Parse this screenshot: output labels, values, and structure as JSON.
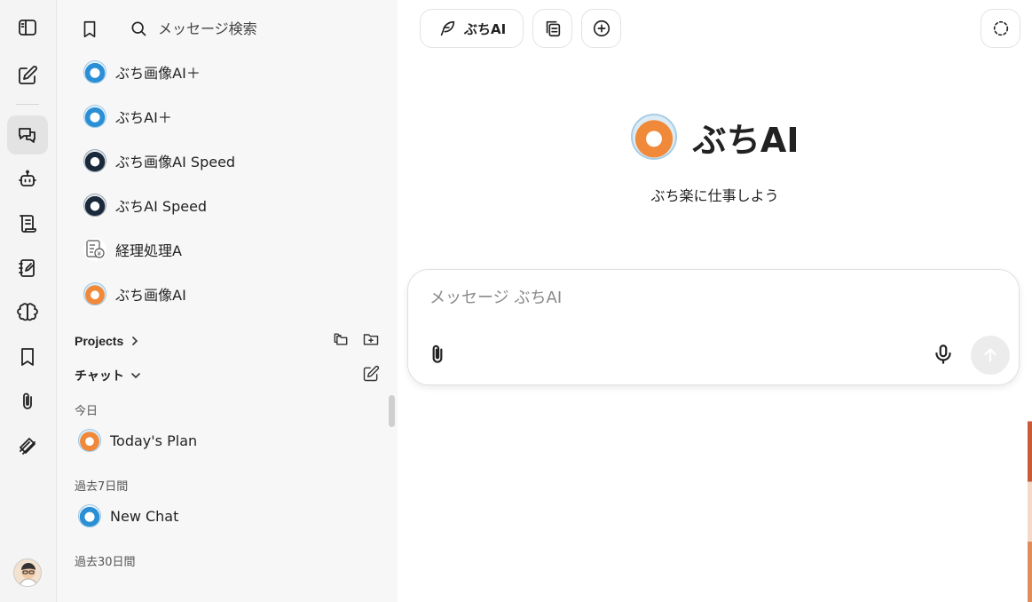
{
  "search": {
    "placeholder": "メッセージ検索"
  },
  "models": [
    {
      "label": "ぶち画像AI＋",
      "avatar": "blue"
    },
    {
      "label": "ぶちAI＋",
      "avatar": "blue"
    },
    {
      "label": "ぶち画像AI Speed",
      "avatar": "dark"
    },
    {
      "label": "ぶちAI Speed",
      "avatar": "dark"
    },
    {
      "label": "経理処理A",
      "avatar": "doc"
    },
    {
      "label": "ぶち画像AI",
      "avatar": "orange"
    }
  ],
  "projects": {
    "title": "Projects"
  },
  "chats": {
    "title": "チャット",
    "groups": [
      {
        "label": "今日",
        "items": [
          {
            "label": "Today's Plan",
            "avatar": "orange"
          }
        ]
      },
      {
        "label": "過去7日間",
        "items": [
          {
            "label": "New Chat",
            "avatar": "blue"
          }
        ]
      },
      {
        "label": "過去30日間",
        "items": []
      }
    ]
  },
  "main": {
    "model_button": "ぶちAI",
    "hero_title": "ぶちAI",
    "hero_subtitle": "ぶち楽に仕事しよう",
    "composer_placeholder": "メッセージ ぶちAI"
  },
  "icons": {
    "rail": [
      "sidebar-toggle-icon",
      "new-note-icon",
      "chats-icon",
      "bot-icon",
      "scroll-icon",
      "notebook-icon",
      "brain-icon",
      "bookmark-icon",
      "paperclip-icon",
      "layers-icon"
    ],
    "top": [
      "feather-icon",
      "copy-icon",
      "plus-circle-icon",
      "dashed-circle-icon"
    ]
  },
  "colors": {
    "active_rail": "#e3e3e3",
    "panel_bg": "#f7f7f7",
    "send_disabled": "#ececec"
  }
}
